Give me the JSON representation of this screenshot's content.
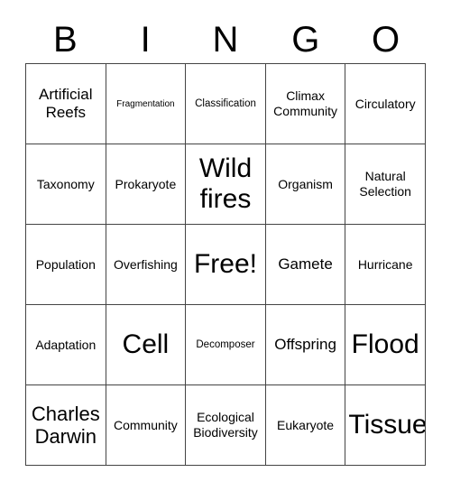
{
  "card": {
    "title": "Bingo Card",
    "header_letters": [
      "B",
      "I",
      "N",
      "G",
      "O"
    ],
    "border_color": "#444444",
    "text_color": "#000000",
    "background_color": "#ffffff",
    "rows": 5,
    "columns": 5,
    "free_space": "Free!",
    "cells": [
      [
        {
          "text": "Artificial Reefs",
          "size": "sz-l"
        },
        {
          "text": "Fragmentation",
          "size": "sz-xs"
        },
        {
          "text": "Classification",
          "size": "sz-s"
        },
        {
          "text": "Climax Community",
          "size": "sz-m"
        },
        {
          "text": "Circulatory",
          "size": "sz-m"
        }
      ],
      [
        {
          "text": "Taxonomy",
          "size": "sz-m"
        },
        {
          "text": "Prokaryote",
          "size": "sz-m"
        },
        {
          "text": "Wild fires",
          "size": "sz-xxl"
        },
        {
          "text": "Organism",
          "size": "sz-m"
        },
        {
          "text": "Natural Selection",
          "size": "sz-m"
        }
      ],
      [
        {
          "text": "Population",
          "size": "sz-m"
        },
        {
          "text": "Overfishing",
          "size": "sz-m"
        },
        {
          "text": "Free!",
          "size": "sz-xxl"
        },
        {
          "text": "Gamete",
          "size": "sz-l"
        },
        {
          "text": "Hurricane",
          "size": "sz-m"
        }
      ],
      [
        {
          "text": "Adaptation",
          "size": "sz-m"
        },
        {
          "text": "Cell",
          "size": "sz-xxl"
        },
        {
          "text": "Decomposer",
          "size": "sz-s"
        },
        {
          "text": "Offspring",
          "size": "sz-l"
        },
        {
          "text": "Flood",
          "size": "sz-xxl"
        }
      ],
      [
        {
          "text": "Charles Darwin",
          "size": "sz-xl"
        },
        {
          "text": "Community",
          "size": "sz-m"
        },
        {
          "text": "Ecological Biodiversity",
          "size": "sz-m"
        },
        {
          "text": "Eukaryote",
          "size": "sz-m"
        },
        {
          "text": "Tissue",
          "size": "sz-xxl"
        }
      ]
    ]
  }
}
